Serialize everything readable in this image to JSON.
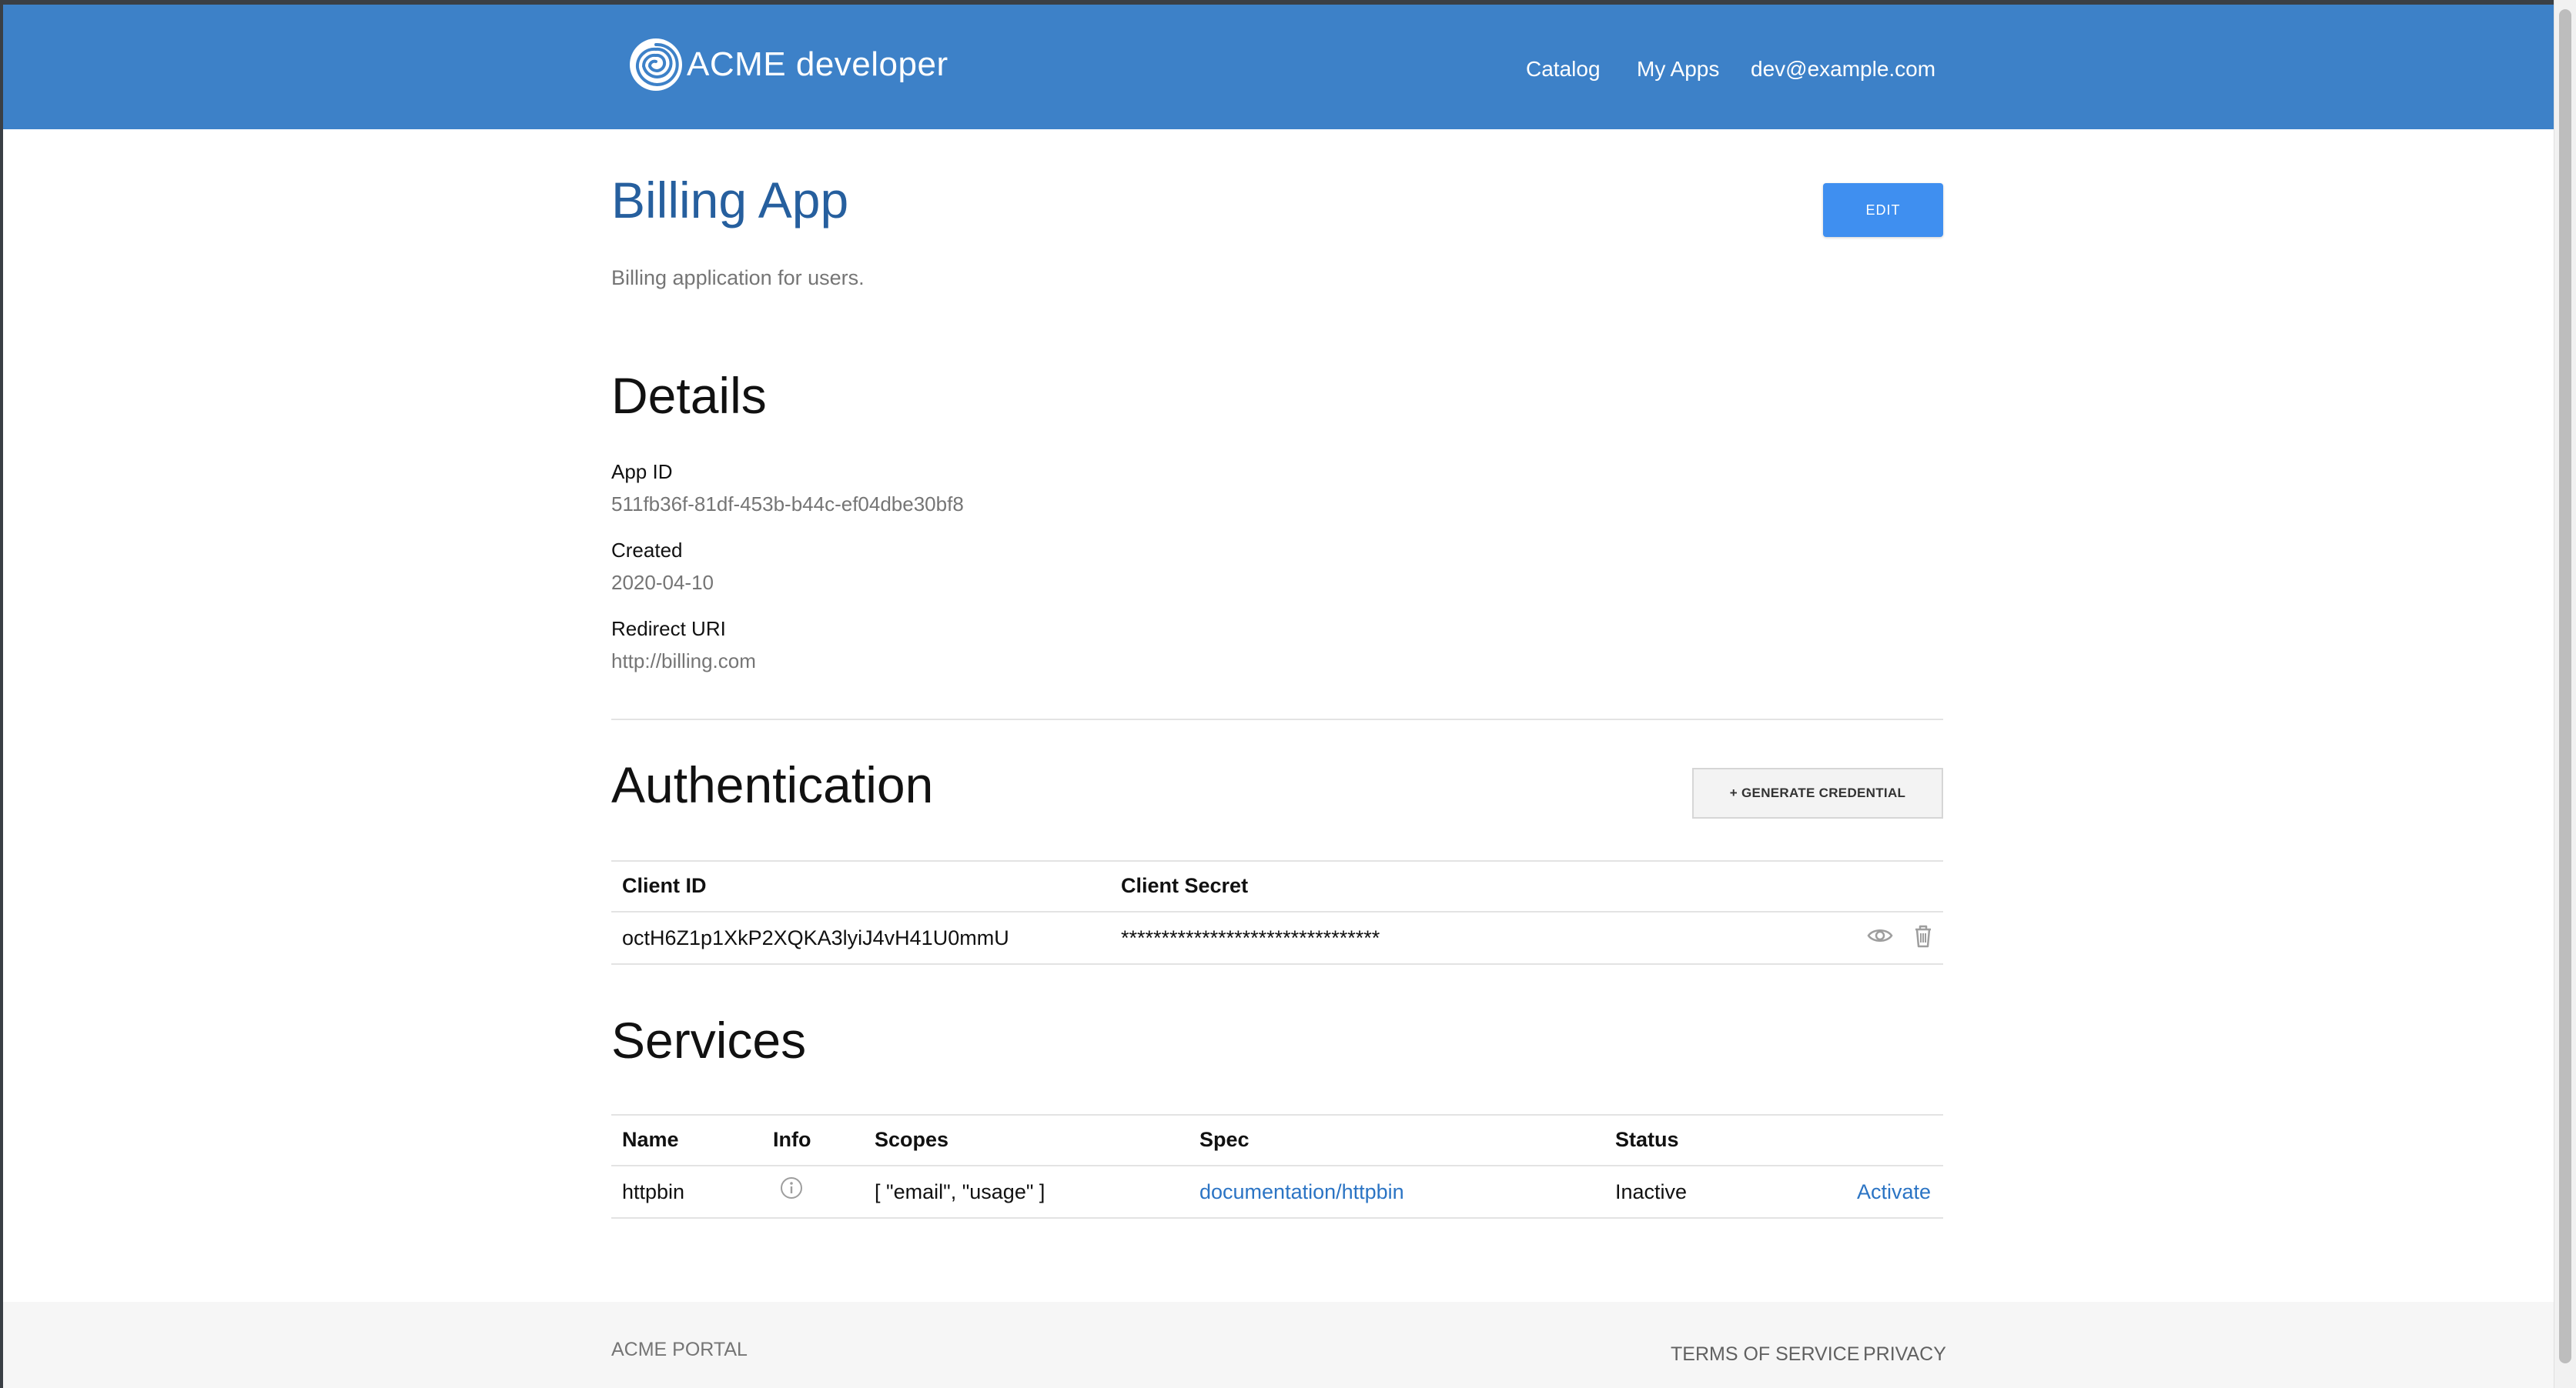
{
  "header": {
    "brand": "ACME developer",
    "logo_icon": "spiral-logo-icon",
    "nav": {
      "catalog": "Catalog",
      "my_apps": "My Apps",
      "user": "dev@example.com"
    },
    "background": "#3d81c8"
  },
  "app": {
    "title": "Billing App",
    "description": "Billing application for users.",
    "edit_label": "EDIT"
  },
  "details": {
    "title": "Details",
    "fields": [
      {
        "label": "App ID",
        "value": "511fb36f-81df-453b-b44c-ef04dbe30bf8"
      },
      {
        "label": "Created",
        "value": "2020-04-10"
      },
      {
        "label": "Redirect URI",
        "value": "http://billing.com"
      }
    ]
  },
  "authentication": {
    "title": "Authentication",
    "generate_label": "+ GENERATE CREDENTIAL",
    "columns": {
      "client_id": "Client ID",
      "client_secret": "Client Secret"
    },
    "rows": [
      {
        "client_id": "octH6Z1p1XkP2XQKA3lyiJ4vH41U0mmU",
        "client_secret": "********************************",
        "icons": [
          "eye-icon",
          "trash-icon"
        ]
      }
    ]
  },
  "services": {
    "title": "Services",
    "columns": {
      "name": "Name",
      "info": "Info",
      "scopes": "Scopes",
      "spec": "Spec",
      "status": "Status"
    },
    "rows": [
      {
        "name": "httpbin",
        "info_icon": "info-icon",
        "scopes": "[ \"email\", \"usage\" ]",
        "spec": "documentation/httpbin",
        "status": "Inactive",
        "action": "Activate"
      }
    ]
  },
  "footer": {
    "brand": "ACME PORTAL",
    "terms": "TERMS OF SERVICE",
    "privacy": "PRIVACY"
  },
  "colors": {
    "accent": "#3f8ff0",
    "title": "#265f9e",
    "link": "#2b74c4"
  }
}
